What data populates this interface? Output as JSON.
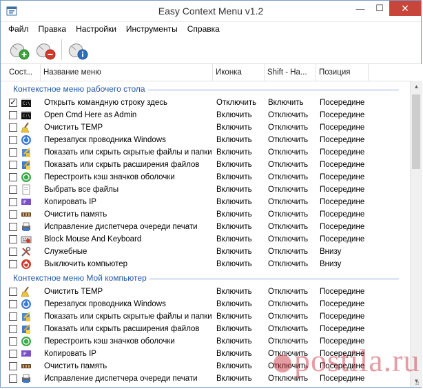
{
  "window": {
    "title": "Easy Context Menu v1.2",
    "minimize": "—",
    "maximize": "☐",
    "close": "✕"
  },
  "menu": [
    "Файл",
    "Правка",
    "Настройки",
    "Инструменты",
    "Справка"
  ],
  "toolbar": [
    {
      "name": "add-menu-button",
      "icon": "mouse-plus-icon",
      "accent": "#3aa63a"
    },
    {
      "name": "remove-menu-button",
      "icon": "mouse-minus-icon",
      "accent": "#d23a2a"
    },
    {
      "name": "info-button",
      "icon": "mouse-info-icon",
      "accent": "#2f6cc0"
    }
  ],
  "columns": [
    "Сост...",
    "Название меню",
    "Иконка",
    "Shift - На...",
    "Позиция"
  ],
  "groups": [
    {
      "title": "Контекстное меню рабочего стола",
      "rows": [
        {
          "checked": true,
          "icon": "cmd-icon",
          "name": "Открыть командную строку здесь",
          "icon_action": "Отключить",
          "shift": "Включить",
          "pos": "Посередине"
        },
        {
          "checked": false,
          "icon": "cmd-icon",
          "name": "Open Cmd Here as Admin",
          "icon_action": "Включить",
          "shift": "Отключить",
          "pos": "Посередине"
        },
        {
          "checked": false,
          "icon": "broom-icon",
          "name": "Очистить TEMP",
          "icon_action": "Включить",
          "shift": "Отключить",
          "pos": "Посередине"
        },
        {
          "checked": false,
          "icon": "restart-icon",
          "name": "Перезапуск проводника Windows",
          "icon_action": "Включить",
          "shift": "Отключить",
          "pos": "Посередине"
        },
        {
          "checked": false,
          "icon": "toggle-files-icon",
          "name": "Показать или скрыть скрытые файлы и папки",
          "icon_action": "Включить",
          "shift": "Отключить",
          "pos": "Посередине"
        },
        {
          "checked": false,
          "icon": "toggle-ext-icon",
          "name": "Показать или скрыть расширения файлов",
          "icon_action": "Включить",
          "shift": "Отключить",
          "pos": "Посередине"
        },
        {
          "checked": false,
          "icon": "rebuild-icon",
          "name": "Перестроить кэш значков оболочки",
          "icon_action": "Включить",
          "shift": "Отключить",
          "pos": "Посередине"
        },
        {
          "checked": false,
          "icon": "select-all-icon",
          "name": "Выбрать все файлы",
          "icon_action": "Включить",
          "shift": "Отключить",
          "pos": "Посередине"
        },
        {
          "checked": false,
          "icon": "ip-icon",
          "name": "Копировать IP",
          "icon_action": "Включить",
          "shift": "Отключить",
          "pos": "Посередине"
        },
        {
          "checked": false,
          "icon": "memory-icon",
          "name": "Очистить память",
          "icon_action": "Включить",
          "shift": "Отключить",
          "pos": "Посередине"
        },
        {
          "checked": false,
          "icon": "print-queue-icon",
          "name": "Исправление диспетчера очереди печати",
          "icon_action": "Включить",
          "shift": "Отключить",
          "pos": "Посередине"
        },
        {
          "checked": false,
          "icon": "keyboard-icon",
          "name": "Block Mouse And Keyboard",
          "icon_action": "Включить",
          "shift": "Отключить",
          "pos": "Посередине"
        },
        {
          "checked": false,
          "icon": "tools-icon",
          "name": "Служебные",
          "icon_action": "Включить",
          "shift": "Отключить",
          "pos": "Внизу"
        },
        {
          "checked": false,
          "icon": "power-icon",
          "name": "Выключить компьютер",
          "icon_action": "Включить",
          "shift": "Отключить",
          "pos": "Внизу"
        }
      ]
    },
    {
      "title": "Контекстное меню Мой компьютер",
      "rows": [
        {
          "checked": false,
          "icon": "broom-icon",
          "name": "Очистить TEMP",
          "icon_action": "Включить",
          "shift": "Отключить",
          "pos": "Посередине"
        },
        {
          "checked": false,
          "icon": "restart-icon",
          "name": "Перезапуск проводника Windows",
          "icon_action": "Включить",
          "shift": "Отключить",
          "pos": "Посередине"
        },
        {
          "checked": false,
          "icon": "toggle-files-icon",
          "name": "Показать или скрыть скрытые файлы и папки",
          "icon_action": "Включить",
          "shift": "Отключить",
          "pos": "Посередине"
        },
        {
          "checked": false,
          "icon": "toggle-ext-icon",
          "name": "Показать или скрыть расширения файлов",
          "icon_action": "Включить",
          "shift": "Отключить",
          "pos": "Посередине"
        },
        {
          "checked": false,
          "icon": "rebuild-icon",
          "name": "Перестроить кэш значков оболочки",
          "icon_action": "Включить",
          "shift": "Отключить",
          "pos": "Посередине"
        },
        {
          "checked": false,
          "icon": "ip-icon",
          "name": "Копировать IP",
          "icon_action": "Включить",
          "shift": "Отключить",
          "pos": "Посередине"
        },
        {
          "checked": false,
          "icon": "memory-icon",
          "name": "Очистить память",
          "icon_action": "Включить",
          "shift": "Отключить",
          "pos": "Посередине"
        },
        {
          "checked": false,
          "icon": "print-queue-icon",
          "name": "Исправление диспетчера очереди печати",
          "icon_action": "Включить",
          "shift": "Отключить",
          "pos": "Посередине"
        }
      ]
    }
  ],
  "watermark": "postila.ru",
  "colors": {
    "group_title": "#1f56a8",
    "close_bg": "#c7453a",
    "watermark": "#c82332"
  }
}
